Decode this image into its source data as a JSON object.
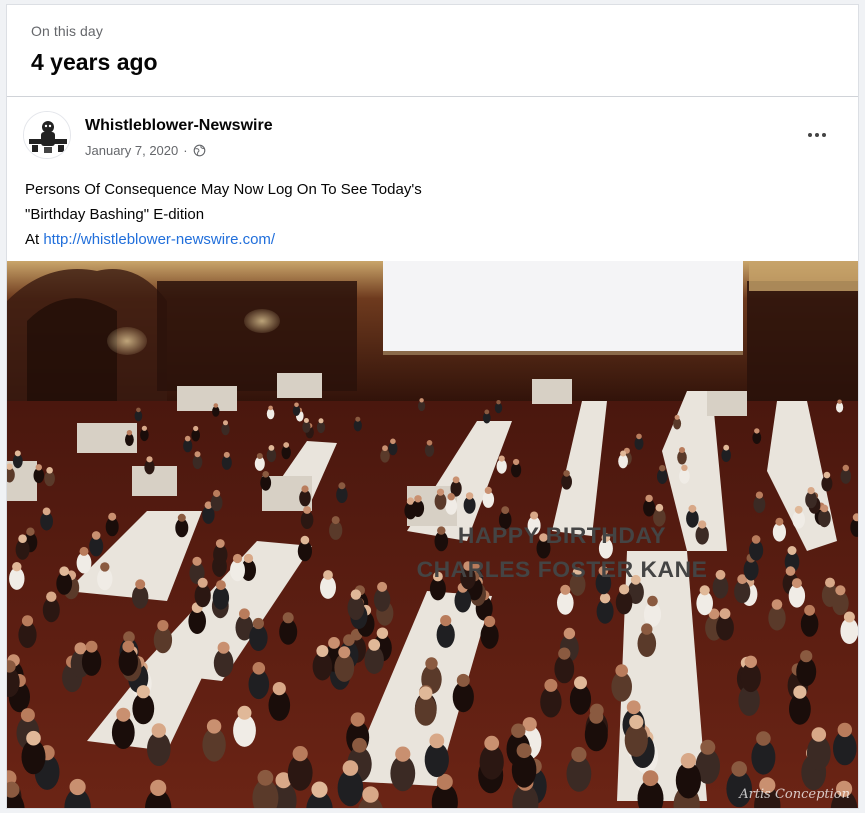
{
  "memory": {
    "kicker": "On this day",
    "title": "4 years ago"
  },
  "post": {
    "page_name": "Whistleblower-Newswire",
    "date": "January 7, 2020",
    "audience_icon": "globe-icon",
    "more_icon": "more-options-icon",
    "text_line1": "Persons Of Consequence May Now Log On To See Today's",
    "text_line2": "\"Birthday Bashing\" E-dition",
    "text_line3_prefix": "At ",
    "link": "http://whistleblower-newswire.com/",
    "separator": "·"
  },
  "photo": {
    "banner_line1": "HAPPY BIRTHDAY",
    "banner_line2": "CHARLES FOSTER KANE",
    "credit": "Artis Conception"
  },
  "colors": {
    "link": "#216fdb",
    "hall_floor": "#5a1e12",
    "banner": "#f4f4f6"
  }
}
